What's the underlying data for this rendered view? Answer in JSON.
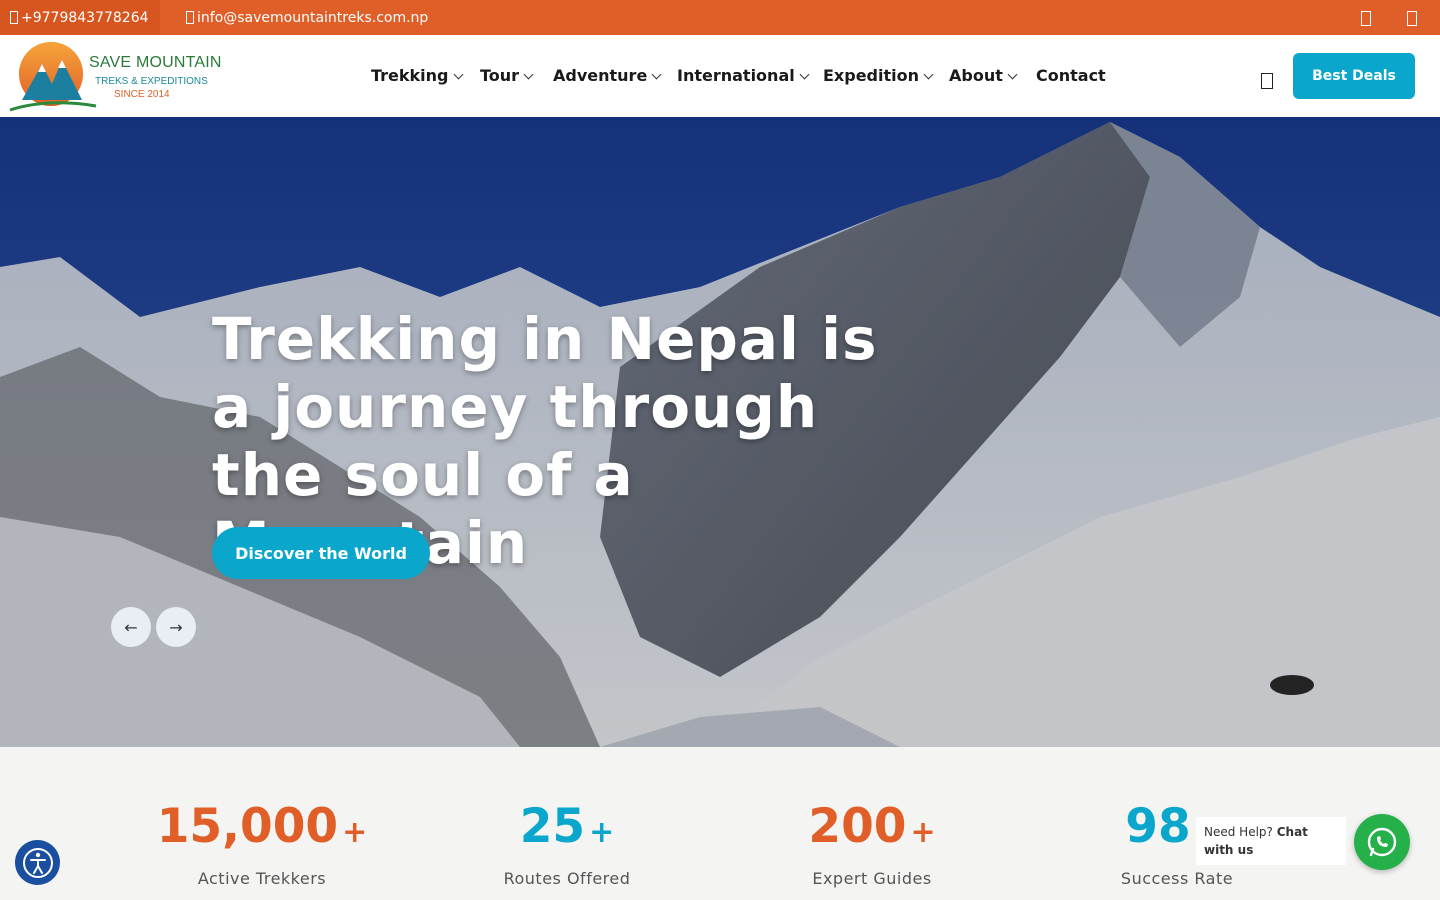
{
  "topbar": {
    "phone": "+9779843778264",
    "email": "info@savemountaintreks.com.np",
    "phone_icon": "phone-icon",
    "email_icon": "mail-icon",
    "social_icons": [
      "facebook-icon",
      "instagram-icon"
    ]
  },
  "logo": {
    "title": "SAVE MOUNTAIN",
    "subtitle": "TREKS & EXPEDITIONS",
    "since": "SINCE 2014"
  },
  "nav": {
    "items": [
      {
        "label": "Trekking",
        "dropdown": true
      },
      {
        "label": "Tour",
        "dropdown": true
      },
      {
        "label": "Adventure",
        "dropdown": true
      },
      {
        "label": "International",
        "dropdown": true
      },
      {
        "label": "Expedition",
        "dropdown": true
      },
      {
        "label": "About",
        "dropdown": true
      },
      {
        "label": "Contact",
        "dropdown": false
      }
    ],
    "cta": "Best Deals"
  },
  "hero": {
    "title": "Trekking in Nepal is a journey through the soul of a Mountain",
    "button": "Discover the World",
    "prev_icon": "arrow-left-icon",
    "next_icon": "arrow-right-icon"
  },
  "stats": [
    {
      "number": "15,000",
      "suffix": "+",
      "label": "Active Trekkers",
      "color": "#e05f28"
    },
    {
      "number": "25",
      "suffix": "+",
      "label": "Routes Offered",
      "color": "#0aa6cc"
    },
    {
      "number": "200",
      "suffix": "+",
      "label": "Expert Guides",
      "color": "#e05f28"
    },
    {
      "number": "98",
      "suffix": "",
      "label": "Success Rate",
      "color": "#0aa6cc"
    }
  ],
  "help": {
    "prefix": "Need Help?",
    "strong": "Chat with us"
  },
  "colors": {
    "brand_orange": "#e05f28",
    "accent_teal": "#0aa6cc",
    "whatsapp_green": "#25b04a"
  }
}
